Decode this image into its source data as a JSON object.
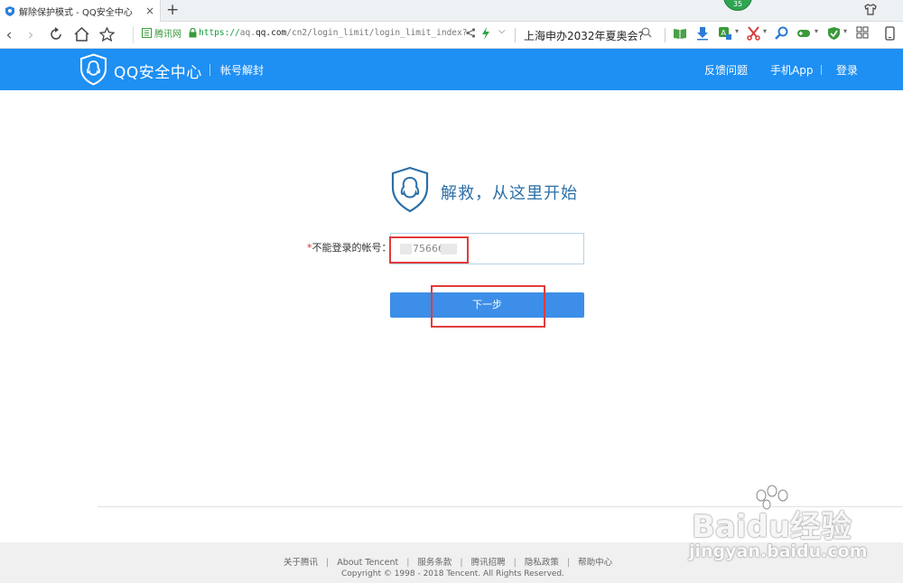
{
  "browser": {
    "tab_title": "解除保护模式 - QQ安全中心",
    "tab_close": "×",
    "new_tab": "+",
    "badge": "35",
    "site_rating": "腾讯网",
    "url_scheme": "https://",
    "url_host_pre": "aq.",
    "url_host": "qq.com",
    "url_path": "/cn2/login_limit/login_limit_index?",
    "search_text": "上海申办2032年夏奥会?"
  },
  "header": {
    "brand": "QQ安全中心",
    "subtitle": "帐号解封",
    "links": [
      "反馈问题",
      "手机App",
      "登录"
    ]
  },
  "form": {
    "hero_title": "解救，从这里开始",
    "required_mark": "*",
    "label": "不能登录的帐号：",
    "account_value": "75666",
    "next_button": "下一步"
  },
  "footer": {
    "links": [
      "关于腾讯",
      "About Tencent",
      "服务条款",
      "腾讯招聘",
      "隐私政策",
      "帮助中心"
    ],
    "copyright": "Copyright © 1998 - 2018 Tencent. All Rights Reserved."
  },
  "watermark": {
    "brand": "Baidu经验",
    "url": "jingyan.baidu.com"
  },
  "colors": {
    "header_bg": "#1e8ff3",
    "button_bg": "#3c8ee8",
    "highlight": "#e13c3c",
    "title_blue": "#2b6fa8"
  }
}
